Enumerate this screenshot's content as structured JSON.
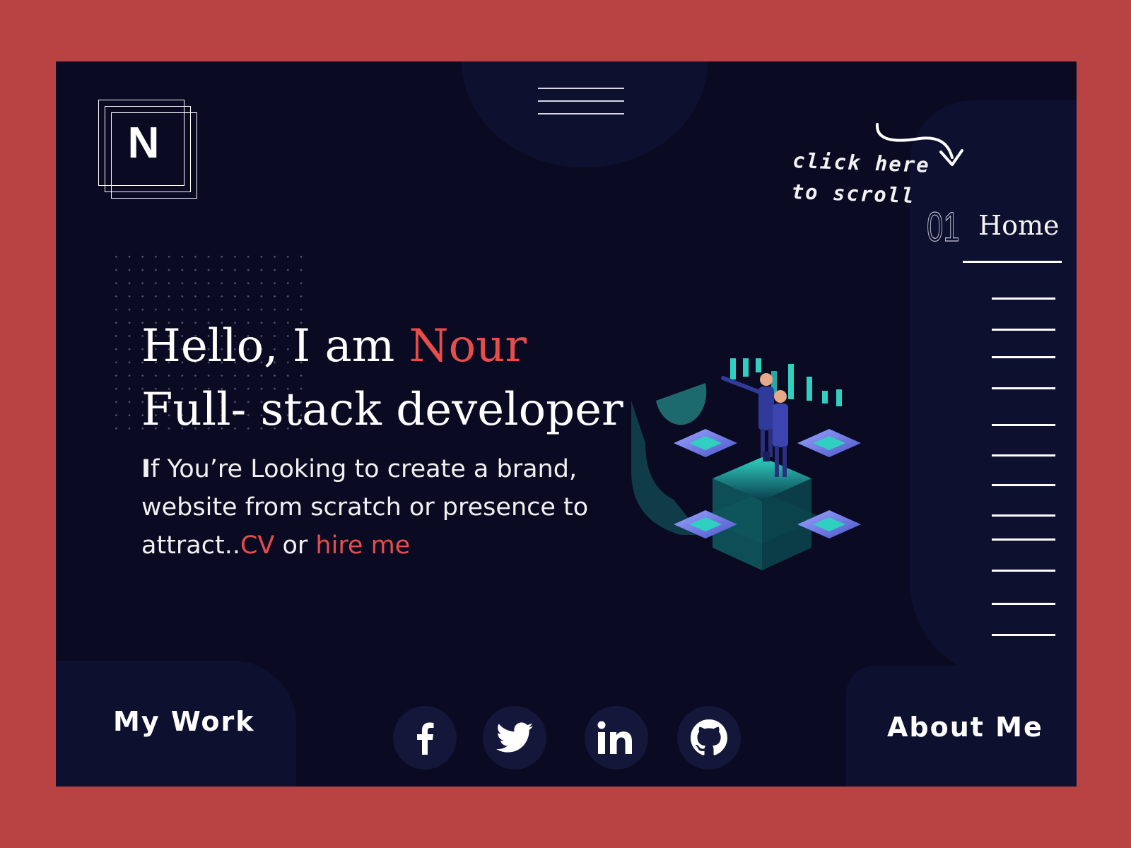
{
  "logo": {
    "letter": "N"
  },
  "scroll_hint": {
    "line1": "click here",
    "line2": "to scroll"
  },
  "nav": {
    "current_number": "01",
    "current_label": "Home",
    "section_ticks": 12
  },
  "hero": {
    "greeting": "Hello, I am ",
    "name": "Nour",
    "role": "Full- stack developer",
    "intro_first_letter": "I",
    "intro_text": "f You’re Looking to create a brand, website from scratch or presence to attract..",
    "cv_link": "CV",
    "connector": " or ",
    "hire_link": "hire me"
  },
  "footer": {
    "left_link": "My Work",
    "right_link": "About Me",
    "social": [
      {
        "icon": "facebook-icon"
      },
      {
        "icon": "twitter-icon"
      },
      {
        "icon": "linkedin-icon"
      },
      {
        "icon": "github-icon"
      }
    ]
  },
  "colors": {
    "outer_background": "#b94342",
    "page_background": "#0a0b22",
    "accent": "#e84c4b",
    "text": "#ffffff",
    "icon_circle": "#14163a"
  }
}
